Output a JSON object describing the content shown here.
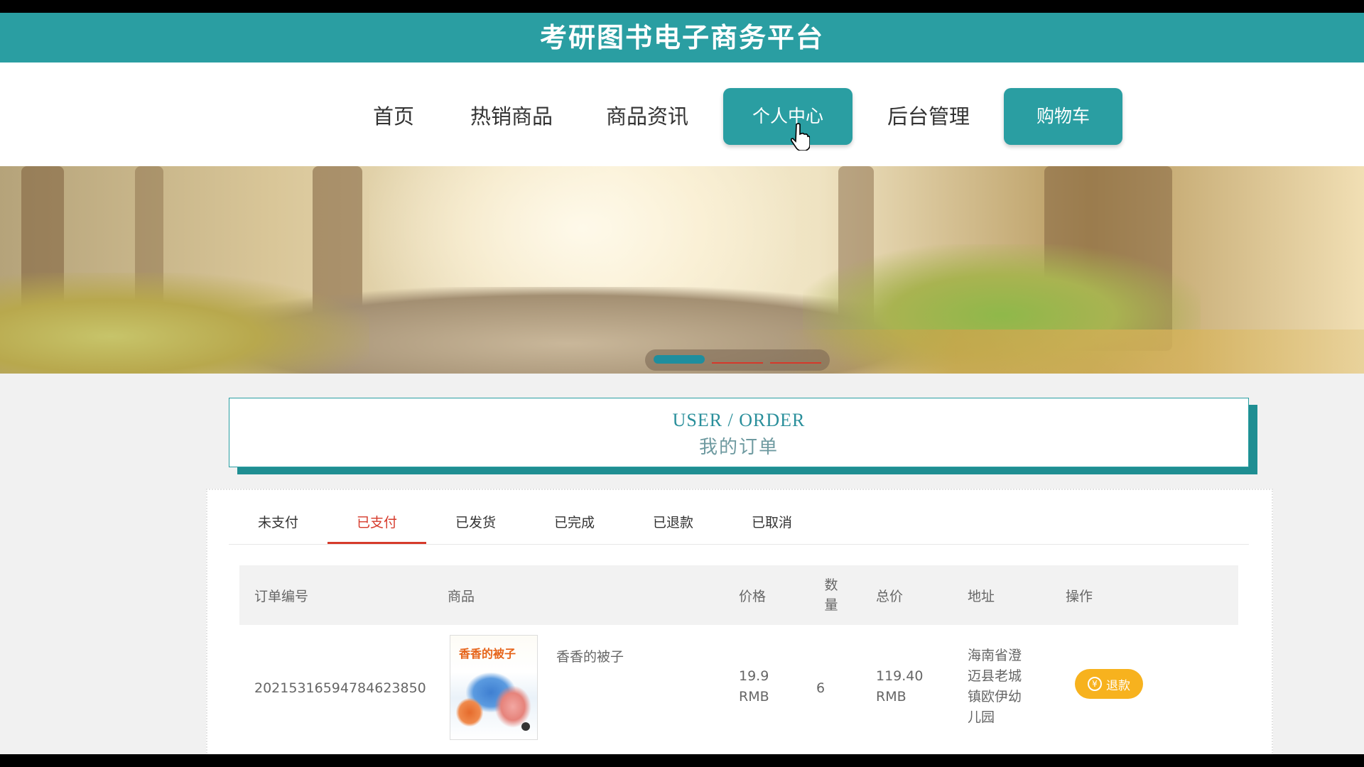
{
  "header": {
    "title": "考研图书电子商务平台"
  },
  "nav": {
    "items": [
      {
        "label": "首页"
      },
      {
        "label": "热销商品"
      },
      {
        "label": "商品资讯"
      },
      {
        "label": "个人中心"
      },
      {
        "label": "后台管理"
      },
      {
        "label": "购物车"
      }
    ]
  },
  "banner": {
    "slide_count": 3,
    "active_slide": 1
  },
  "order_section": {
    "title_en": "USER / ORDER",
    "title_cn": "我的订单"
  },
  "tabs": [
    {
      "label": "未支付"
    },
    {
      "label": "已支付"
    },
    {
      "label": "已发货"
    },
    {
      "label": "已完成"
    },
    {
      "label": "已退款"
    },
    {
      "label": "已取消"
    }
  ],
  "active_tab": "已支付",
  "table": {
    "headers": {
      "order_no": "订单编号",
      "product": "商品",
      "price": "价格",
      "qty_line1": "数",
      "qty_line2": "量",
      "total": "总价",
      "address": "地址",
      "action": "操作"
    },
    "rows": [
      {
        "order_no": "20215316594784623850",
        "product_cover_title": "香香的被子",
        "product_name": "香香的被子",
        "price": "19.9",
        "price_unit": "RMB",
        "qty": "6",
        "total": "119.40",
        "total_unit": "RMB",
        "address_lines": [
          "海南省澄",
          "迈县老城",
          "镇欧伊幼",
          "儿园"
        ],
        "action_label": "退款",
        "action_icon": "yen-icon"
      }
    ]
  },
  "colors": {
    "primary": "#2a9ea2",
    "active_tab": "#d63a2b",
    "refund_button": "#f7b21e"
  }
}
